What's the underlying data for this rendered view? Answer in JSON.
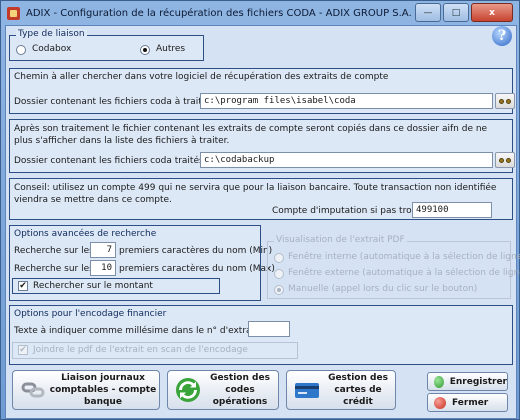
{
  "window": {
    "title": "ADIX - Configuration de la récupération des fichiers CODA - ADIX GROUP S.A.",
    "minimize": "—",
    "maximize": "□",
    "close": "x"
  },
  "type_liaison": {
    "legend": "Type de liaison",
    "codabox": "Codabox",
    "autres": "Autres",
    "selected": "autres"
  },
  "chemin": {
    "intro": "Chemin à aller chercher dans votre logiciel de récupération des extraits de compte",
    "label": "Dossier contenant les fichiers coda à traiter",
    "value": "c:\\program files\\isabel\\coda"
  },
  "traites": {
    "intro": "Après son traitement le fichier contenant les extraits de compte seront copiés dans ce dossier aifn de ne plus s'afficher dans la liste des fichiers à traiter.",
    "label": "Dossier contenant les fichiers coda traités",
    "value": "c:\\codabackup"
  },
  "conseil": {
    "text": "Conseil: utilisez un compte 499 qui ne servira que pour la liaison bancaire. Toute transaction non identifiée viendra se mettre dans ce compte.",
    "label": "Compte d'imputation si pas trouvé",
    "value": "499100"
  },
  "recherche": {
    "legend": "Options avancées de recherche",
    "row1_prefix": "Recherche sur les",
    "row1_value": "7",
    "row1_suffix": "premiers caractères du nom (Min)",
    "row2_prefix": "Recherche sur les",
    "row2_value": "10",
    "row2_suffix": "premiers caractères du nom (Max)",
    "montant_label": "Rechercher sur le montant",
    "montant_checked": true
  },
  "visualisation": {
    "legend": "Visualisation de l'extrait PDF",
    "opt1": "Fenêtre interne (automatique à la sélection de ligne)",
    "opt2": "Fenêtre externe (automatique à la sélection de ligne)",
    "opt3": "Manuelle (appel lors du clic sur le bouton)",
    "selected": "opt3"
  },
  "encodage": {
    "legend": "Options pour l'encodage financier",
    "label": "Texte à indiquer comme millésime dans le n° d'extrait",
    "value": "",
    "joindre_label": "Joindre le pdf de l'extrait en scan de l'encodage",
    "joindre_checked": true
  },
  "buttons": {
    "liaison": "Liaison journaux comptables - compte banque",
    "operations": "Gestion des codes opérations",
    "cartes": "Gestion des cartes de crédit",
    "enregistrer": "Enregistrer",
    "fermer": "Fermer"
  },
  "colors": {
    "panel_border": "#2c4f86",
    "enregistrer_dot": "#2e9b2e",
    "fermer_dot": "#cc2a1c"
  }
}
